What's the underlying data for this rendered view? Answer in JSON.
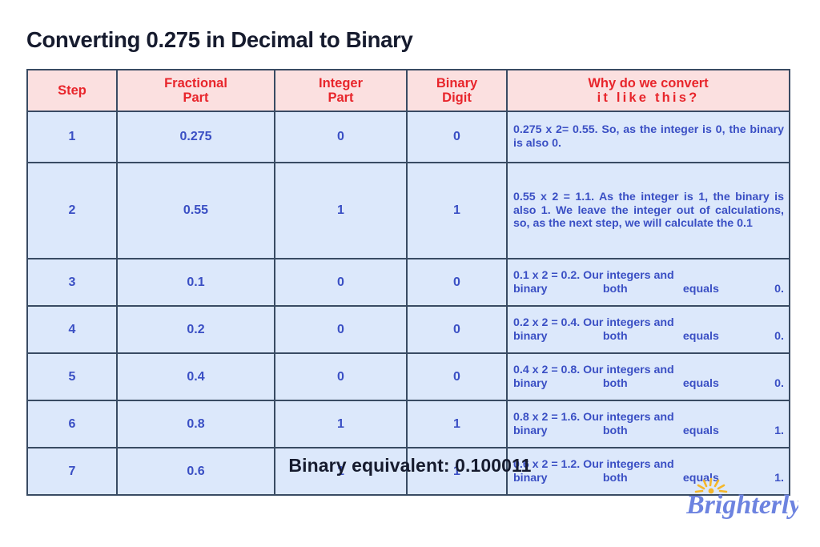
{
  "title": "Converting 0.275 in Decimal to Binary",
  "table": {
    "headers": {
      "step": "Step",
      "fractional_part_line1": "Fractional",
      "fractional_part_line2": "Part",
      "integer_part_line1": "Integer",
      "integer_part_line2": "Part",
      "binary_digit_line1": "Binary",
      "binary_digit_line2": "Digit",
      "why_line1": "Why do we convert",
      "why_line2": "it like this?"
    },
    "rows": [
      {
        "step": "1",
        "fractional_part": "0.275",
        "integer_part": "0",
        "binary_digit": "0",
        "why": "0.275 x 2= 0.55. So, as the integer is 0, the binary is also 0."
      },
      {
        "step": "2",
        "fractional_part": "0.55",
        "integer_part": "1",
        "binary_digit": "1",
        "why": "0.55 x 2 = 1.1. As the integer is 1, the binary is also 1. We leave the integer out of calculations, so, as the next step, we will calculate the 0.1"
      },
      {
        "step": "3",
        "fractional_part": "0.1",
        "integer_part": "0",
        "binary_digit": "0",
        "why_line1": "0.1 x 2 = 0.2. Our integers and",
        "why_line2": "binary both equals 0."
      },
      {
        "step": "4",
        "fractional_part": "0.2",
        "integer_part": "0",
        "binary_digit": "0",
        "why_line1": "0.2 x 2 = 0.4. Our integers and",
        "why_line2": "binary both equals 0."
      },
      {
        "step": "5",
        "fractional_part": "0.4",
        "integer_part": "0",
        "binary_digit": "0",
        "why_line1": "0.4 x 2 = 0.8. Our integers and",
        "why_line2": "binary both equals 0."
      },
      {
        "step": "6",
        "fractional_part": "0.8",
        "integer_part": "1",
        "binary_digit": "1",
        "why_line1": "0.8 x 2 = 1.6. Our integers and",
        "why_line2": "binary both equals 1."
      },
      {
        "step": "7",
        "fractional_part": "0.6",
        "integer_part": "1",
        "binary_digit": "1",
        "why_line1": "0.6 x 2 = 1.2. Our integers and",
        "why_line2": "binary both equals 1."
      }
    ]
  },
  "footer": {
    "binary_equivalent": "Binary equivalent:  0.100011"
  },
  "logo": {
    "text": "Brighterly",
    "wordmark_color": "#6d83e0",
    "sun_color": "#f5b72a"
  },
  "colors": {
    "header_bg": "#fbe0e0",
    "header_text": "#e8252b",
    "cell_bg": "#dce8fb",
    "cell_text": "#3a4fc4",
    "border": "#394b63",
    "title_text": "#161b2e",
    "page_bg": "#ffffff"
  }
}
